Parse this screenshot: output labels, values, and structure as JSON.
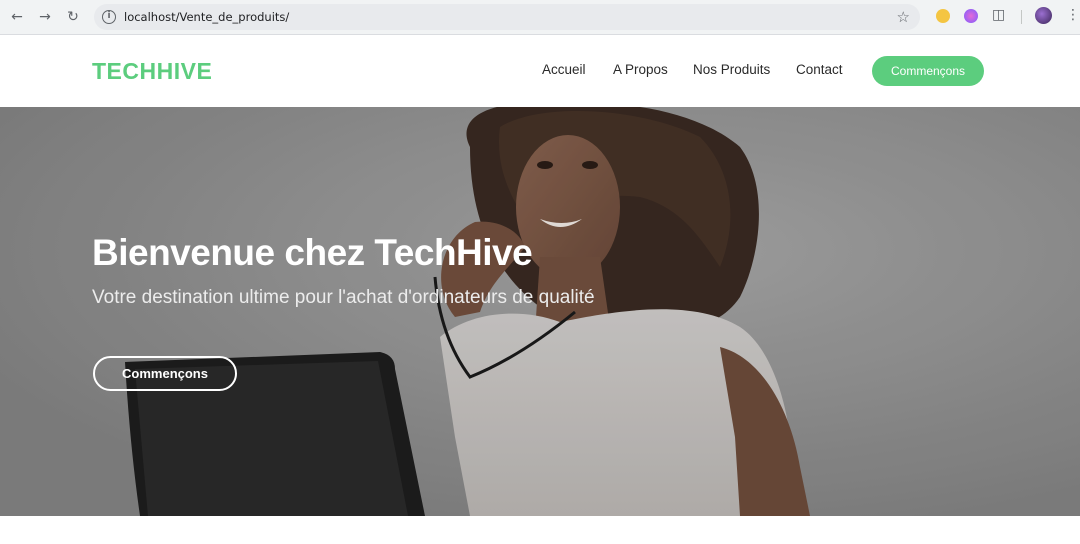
{
  "browser": {
    "url": "localhost/Vente_de_produits/",
    "back_icon": "arrow-left-icon",
    "forward_icon": "arrow-right-icon",
    "reload_icon": "reload-icon"
  },
  "site": {
    "logo": "TECHHIVE",
    "brand_color": "#5ccd7e",
    "nav": [
      {
        "label": "Accueil"
      },
      {
        "label": "A Propos"
      },
      {
        "label": "Nos Produits"
      },
      {
        "label": "Contact"
      }
    ],
    "cta_label": "Commençons"
  },
  "hero": {
    "title": "Bienvenue chez TechHive",
    "subtitle": "Votre destination ultime pour l'achat d'ordinateurs de qualité",
    "button_label": "Commençons"
  }
}
